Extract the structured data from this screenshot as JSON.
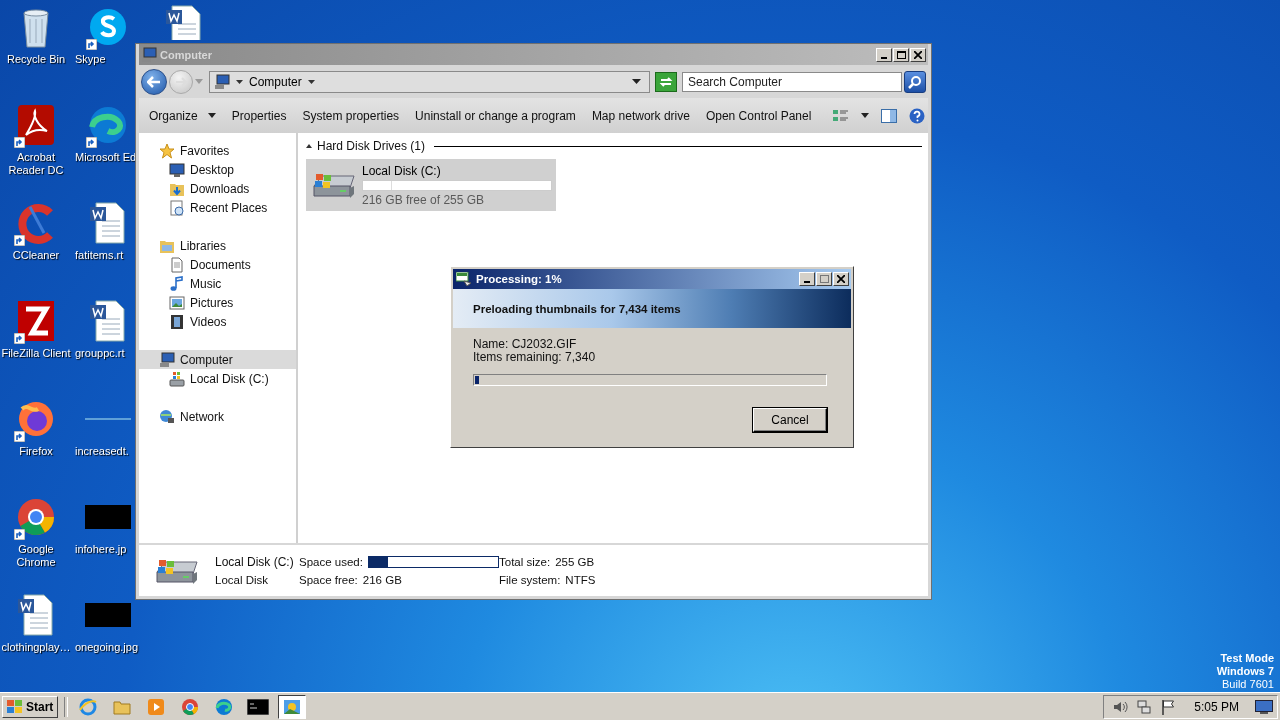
{
  "desktop_icons": [
    {
      "label": "Recycle Bin",
      "kind": "recycle",
      "shortcut": false
    },
    {
      "label": "Acrobat Reader DC",
      "kind": "acrobat",
      "shortcut": true
    },
    {
      "label": "CCleaner",
      "kind": "ccleaner",
      "shortcut": true
    },
    {
      "label": "FileZilla Client",
      "kind": "filezilla",
      "shortcut": true
    },
    {
      "label": "Firefox",
      "kind": "firefox",
      "shortcut": true
    },
    {
      "label": "Google Chrome",
      "kind": "chrome",
      "shortcut": true
    },
    {
      "label": "clothingplay…",
      "kind": "word",
      "shortcut": false
    },
    {
      "label": "Skype",
      "kind": "skype",
      "shortcut": true
    },
    {
      "label": "Microsoft Ed",
      "kind": "edge",
      "shortcut": true
    },
    {
      "label": "fatitems.rt",
      "kind": "word",
      "shortcut": false
    },
    {
      "label": "grouppc.rt",
      "kind": "word",
      "shortcut": false
    },
    {
      "label": "increasedt.",
      "kind": "blank",
      "shortcut": false
    },
    {
      "label": "infohere.jp",
      "kind": "image",
      "shortcut": false
    },
    {
      "label": "onegoing.jpg",
      "kind": "image",
      "shortcut": false
    },
    {
      "kind": "word",
      "shortcut": false
    }
  ],
  "explorer": {
    "title": "Computer",
    "address": "Computer",
    "search": {
      "placeholder": "Search Computer"
    },
    "toolbar": [
      {
        "label": "Organize",
        "dropdown": true
      },
      {
        "label": "Properties",
        "dropdown": false
      },
      {
        "label": "System properties",
        "dropdown": false
      },
      {
        "label": "Uninstall or change a program",
        "dropdown": false
      },
      {
        "label": "Map network drive",
        "dropdown": false
      },
      {
        "label": "Open Control Panel",
        "dropdown": false
      }
    ],
    "nav_groups": [
      {
        "label": "Favorites",
        "selected": false,
        "children": [
          {
            "label": "Desktop",
            "selected": false
          },
          {
            "label": "Downloads",
            "selected": false
          },
          {
            "label": "Recent Places",
            "selected": false
          }
        ]
      },
      {
        "label": "Libraries",
        "selected": false,
        "children": [
          {
            "label": "Documents",
            "selected": false
          },
          {
            "label": "Music",
            "selected": false
          },
          {
            "label": "Pictures",
            "selected": false
          },
          {
            "label": "Videos",
            "selected": false
          }
        ]
      },
      {
        "label": "Computer",
        "selected": true,
        "children": [
          {
            "label": "Local Disk (C:)",
            "selected": false
          }
        ]
      },
      {
        "label": "Network",
        "selected": false
      }
    ],
    "group_header": "Hard Disk Drives (1)",
    "drives": [
      {
        "name": "Local Disk (C:)",
        "level": 0.15,
        "free": "216 GB free of 255 GB",
        "selected": true
      }
    ],
    "details": {
      "name": "Local Disk (C:)",
      "type": "Local Disk",
      "fields": [
        {
          "label": "Space used:",
          "kind": "bar",
          "level": 0.15
        },
        {
          "label": "Space free:",
          "kind": "text",
          "value": "216 GB"
        },
        {
          "label": "Total size:",
          "kind": "text",
          "value": "255 GB"
        },
        {
          "label": "File system:",
          "kind": "text",
          "value": "NTFS"
        }
      ]
    }
  },
  "dialog": {
    "title": "Processing: 1%",
    "heading": "Preloading thumbnails for 7,434 items",
    "lines": [
      "Name: CJ2032.GIF",
      "Items remaining: 7,340"
    ],
    "level": 0.01,
    "button": "Cancel"
  },
  "system_notice": [
    {
      "text": "Test Mode",
      "bold": true
    },
    {
      "text": "Windows 7",
      "bold": true
    },
    {
      "text": "Build 7601",
      "bold": false
    }
  ],
  "taskbar": {
    "start": "Start",
    "apps": [
      {
        "kind": "ie",
        "selected": false
      },
      {
        "kind": "explorer",
        "selected": false
      },
      {
        "kind": "media",
        "selected": false
      },
      {
        "kind": "chrome",
        "selected": false
      },
      {
        "kind": "edge",
        "selected": false
      },
      {
        "kind": "cmd",
        "selected": false
      },
      {
        "kind": "image",
        "selected": true
      }
    ],
    "clock": "5:05 PM"
  }
}
